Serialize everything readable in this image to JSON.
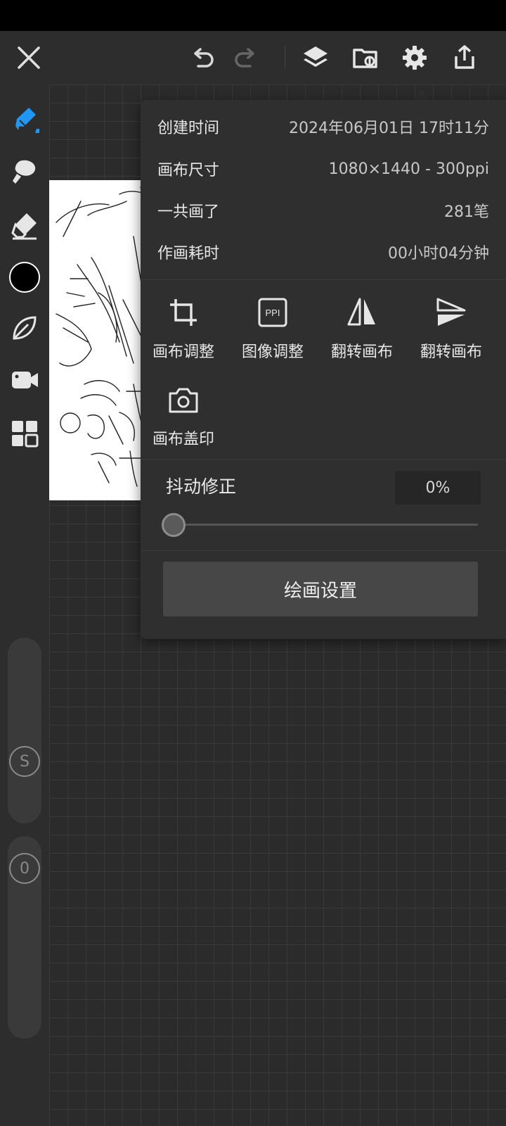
{
  "top_bar": {
    "icons": [
      "close-icon",
      "undo-icon",
      "redo-icon",
      "layers-icon",
      "import-image-icon",
      "gear-icon",
      "share-icon"
    ]
  },
  "left_toolbar": {
    "tools": [
      "pen-icon",
      "smudge-icon",
      "eraser-icon",
      "color-swatch",
      "leaf-icon",
      "video-icon",
      "grid-icon"
    ],
    "current_color": "#000000",
    "size_badge": "S",
    "opacity_badge": "0"
  },
  "settings_panel": {
    "info": [
      {
        "label": "创建时间",
        "value": "2024年06月01日 17时11分"
      },
      {
        "label": "画布尺寸",
        "value": "1080×1440 - 300ppi"
      },
      {
        "label": "一共画了",
        "value": "281笔"
      },
      {
        "label": "作画耗时",
        "value": "00小时04分钟"
      }
    ],
    "tools": [
      {
        "label": "画布调整",
        "icon": "crop-icon"
      },
      {
        "label": "图像调整",
        "icon": "ppi-icon",
        "icon_text": "PPI"
      },
      {
        "label": "翻转画布",
        "icon": "flip-horizontal-icon"
      },
      {
        "label": "翻转画布",
        "icon": "flip-vertical-icon"
      },
      {
        "label": "画布盖印",
        "icon": "camera-icon"
      }
    ],
    "stabilizer": {
      "label": "抖动修正",
      "value": "0%",
      "level": 0
    },
    "paint_settings_button": "绘画设置"
  },
  "colors": {
    "accent": "#2196f3",
    "panel_bg": "#2f2f2f",
    "toolbar_bg": "#2d2d2d"
  }
}
